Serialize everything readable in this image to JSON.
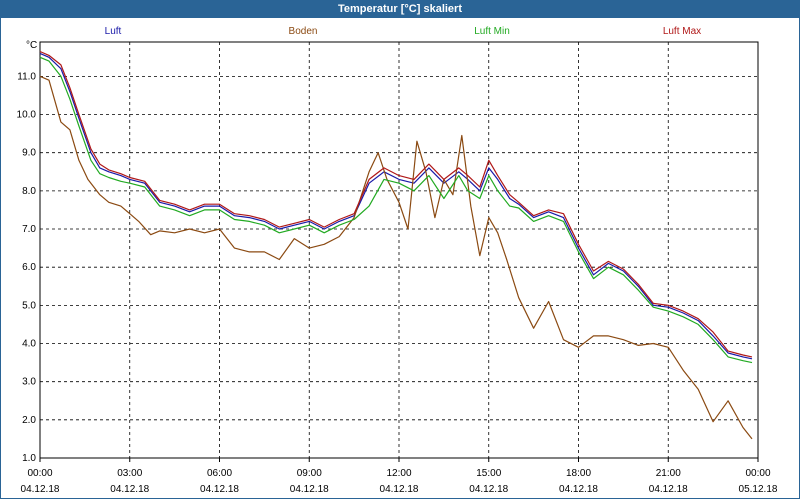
{
  "window": {
    "title": "Temperatur [°C] skaliert"
  },
  "chart_data": {
    "type": "line",
    "title": "Temperatur [°C] skaliert",
    "ylabel": "°C",
    "xlabel": "",
    "ylim": [
      1.0,
      11.9
    ],
    "xlim_hours": [
      0,
      24
    ],
    "grid": true,
    "legend_position": "top",
    "yticks": [
      "1.0",
      "2.0",
      "3.0",
      "4.0",
      "5.0",
      "6.0",
      "7.0",
      "8.0",
      "9.0",
      "10.0",
      "11.0"
    ],
    "xticks": [
      {
        "time": "00:00",
        "date": "04.12.18"
      },
      {
        "time": "03:00",
        "date": "04.12.18"
      },
      {
        "time": "06:00",
        "date": "04.12.18"
      },
      {
        "time": "09:00",
        "date": "04.12.18"
      },
      {
        "time": "12:00",
        "date": "04.12.18"
      },
      {
        "time": "15:00",
        "date": "04.12.18"
      },
      {
        "time": "18:00",
        "date": "04.12.18"
      },
      {
        "time": "21:00",
        "date": "04.12.18"
      },
      {
        "time": "00:00",
        "date": "05.12.18"
      }
    ],
    "series": [
      {
        "name": "Luft",
        "color": "#1a1aa8",
        "hours": [
          0,
          0.3,
          0.7,
          1.0,
          1.3,
          1.7,
          2.0,
          2.3,
          2.7,
          3.0,
          3.5,
          4.0,
          4.5,
          5.0,
          5.5,
          6.0,
          6.5,
          7.0,
          7.5,
          8.0,
          8.5,
          9.0,
          9.5,
          10.0,
          10.5,
          11.0,
          11.5,
          12.0,
          12.5,
          13.0,
          13.5,
          14.0,
          14.3,
          14.7,
          15.0,
          15.3,
          15.7,
          16.0,
          16.5,
          17.0,
          17.5,
          18.0,
          18.5,
          19.0,
          19.5,
          20.0,
          20.5,
          21.0,
          21.5,
          22.0,
          22.5,
          23.0,
          23.5,
          23.8
        ],
        "values": [
          11.6,
          11.5,
          11.2,
          10.6,
          9.9,
          9.0,
          8.6,
          8.5,
          8.4,
          8.3,
          8.2,
          7.7,
          7.6,
          7.45,
          7.6,
          7.6,
          7.35,
          7.3,
          7.2,
          7.0,
          7.1,
          7.2,
          7.0,
          7.2,
          7.35,
          8.2,
          8.5,
          8.3,
          8.2,
          8.6,
          8.2,
          8.5,
          8.3,
          8.0,
          8.6,
          8.3,
          7.8,
          7.65,
          7.3,
          7.45,
          7.3,
          6.5,
          5.8,
          6.1,
          5.9,
          5.5,
          5.0,
          4.95,
          4.8,
          4.6,
          4.2,
          3.75,
          3.65,
          3.6
        ]
      },
      {
        "name": "Boden",
        "color": "#8b4a12",
        "hours": [
          0,
          0.3,
          0.7,
          1.0,
          1.3,
          1.6,
          2.0,
          2.3,
          2.7,
          3.0,
          3.3,
          3.7,
          4.0,
          4.5,
          5.0,
          5.5,
          6.0,
          6.5,
          7.0,
          7.5,
          8.0,
          8.5,
          9.0,
          9.5,
          10.0,
          10.5,
          11.0,
          11.3,
          11.6,
          12.0,
          12.3,
          12.6,
          12.9,
          13.2,
          13.5,
          13.8,
          14.1,
          14.4,
          14.7,
          15.0,
          15.3,
          15.6,
          16.0,
          16.5,
          17.0,
          17.5,
          18.0,
          18.5,
          19.0,
          19.5,
          20.0,
          20.5,
          21.0,
          21.5,
          22.0,
          22.5,
          23.0,
          23.5,
          23.8
        ],
        "values": [
          11.0,
          10.9,
          9.8,
          9.6,
          8.8,
          8.3,
          7.9,
          7.7,
          7.6,
          7.4,
          7.2,
          6.85,
          6.95,
          6.9,
          7.0,
          6.9,
          7.0,
          6.5,
          6.4,
          6.4,
          6.2,
          6.75,
          6.5,
          6.6,
          6.8,
          7.3,
          8.5,
          9.0,
          8.3,
          7.7,
          7.0,
          9.3,
          8.5,
          7.3,
          8.3,
          7.9,
          9.45,
          7.6,
          6.3,
          7.3,
          6.9,
          6.2,
          5.2,
          4.4,
          5.1,
          4.1,
          3.9,
          4.2,
          4.2,
          4.1,
          3.95,
          4.0,
          3.9,
          3.3,
          2.8,
          1.95,
          2.5,
          1.8,
          1.5
        ]
      },
      {
        "name": "Luft Min",
        "color": "#22aa22",
        "hours": [
          0,
          0.3,
          0.7,
          1.0,
          1.3,
          1.7,
          2.0,
          2.3,
          2.7,
          3.0,
          3.5,
          4.0,
          4.5,
          5.0,
          5.5,
          6.0,
          6.5,
          7.0,
          7.5,
          8.0,
          8.5,
          9.0,
          9.5,
          10.0,
          10.5,
          11.0,
          11.5,
          12.0,
          12.5,
          13.0,
          13.5,
          14.0,
          14.3,
          14.7,
          15.0,
          15.3,
          15.7,
          16.0,
          16.5,
          17.0,
          17.5,
          18.0,
          18.5,
          19.0,
          19.5,
          20.0,
          20.5,
          21.0,
          21.5,
          22.0,
          22.5,
          23.0,
          23.5,
          23.8
        ],
        "values": [
          11.5,
          11.4,
          11.0,
          10.4,
          9.7,
          8.8,
          8.45,
          8.35,
          8.25,
          8.2,
          8.1,
          7.6,
          7.5,
          7.35,
          7.5,
          7.5,
          7.25,
          7.2,
          7.1,
          6.9,
          7.0,
          7.1,
          6.9,
          7.1,
          7.25,
          7.6,
          8.3,
          8.2,
          8.0,
          8.4,
          7.8,
          8.4,
          8.0,
          7.8,
          8.4,
          8.0,
          7.6,
          7.55,
          7.2,
          7.35,
          7.2,
          6.4,
          5.7,
          6.0,
          5.8,
          5.4,
          4.95,
          4.85,
          4.7,
          4.5,
          4.1,
          3.65,
          3.55,
          3.5
        ]
      },
      {
        "name": "Luft Max",
        "color": "#b01818",
        "hours": [
          0,
          0.3,
          0.7,
          1.0,
          1.3,
          1.7,
          2.0,
          2.3,
          2.7,
          3.0,
          3.5,
          4.0,
          4.5,
          5.0,
          5.5,
          6.0,
          6.5,
          7.0,
          7.5,
          8.0,
          8.5,
          9.0,
          9.5,
          10.0,
          10.5,
          11.0,
          11.5,
          12.0,
          12.5,
          13.0,
          13.5,
          14.0,
          14.3,
          14.7,
          15.0,
          15.3,
          15.7,
          16.0,
          16.5,
          17.0,
          17.5,
          18.0,
          18.5,
          19.0,
          19.5,
          20.0,
          20.5,
          21.0,
          21.5,
          22.0,
          22.5,
          23.0,
          23.5,
          23.8
        ],
        "values": [
          11.65,
          11.55,
          11.3,
          10.7,
          10.0,
          9.1,
          8.7,
          8.55,
          8.45,
          8.35,
          8.25,
          7.75,
          7.65,
          7.5,
          7.65,
          7.65,
          7.4,
          7.35,
          7.25,
          7.05,
          7.15,
          7.25,
          7.05,
          7.25,
          7.4,
          8.3,
          8.6,
          8.4,
          8.3,
          8.7,
          8.3,
          8.6,
          8.4,
          8.1,
          8.8,
          8.4,
          7.9,
          7.7,
          7.35,
          7.5,
          7.4,
          6.6,
          5.9,
          6.15,
          5.95,
          5.55,
          5.05,
          5.0,
          4.85,
          4.65,
          4.3,
          3.8,
          3.7,
          3.65
        ]
      }
    ]
  }
}
